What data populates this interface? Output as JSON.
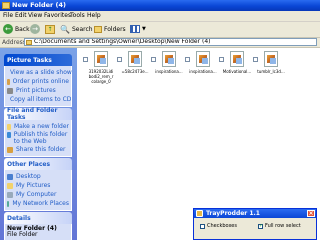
{
  "window": {
    "title": "New Folder (4)"
  },
  "menu": [
    "File",
    "Edit",
    "View",
    "Favorites",
    "Tools",
    "Help"
  ],
  "toolbar": {
    "back_label": "Back",
    "search_label": "Search",
    "folders_label": "Folders"
  },
  "address": {
    "label": "Address",
    "path": "C:\\Documents and Settings\\Owner\\Desktop\\New Folder (4)"
  },
  "sidebar": {
    "picture_tasks": {
      "title": "Picture Tasks",
      "items": [
        "View as a slide show",
        "Order prints online",
        "Print pictures",
        "Copy all items to CD"
      ]
    },
    "file_folder_tasks": {
      "title": "File and Folder Tasks",
      "items": [
        "Make a new folder",
        "Publish this folder to the Web",
        "Share this folder"
      ]
    },
    "other_places": {
      "title": "Other Places",
      "items": [
        "Desktop",
        "My Pictures",
        "My Computer",
        "My Network Places"
      ]
    },
    "details": {
      "title": "Details",
      "name": "New Folder (4)",
      "type": "File Folder"
    }
  },
  "files": [
    {
      "name": "3192032Lidi\nbodi2_rem_r\ncolarge_0"
    },
    {
      "name": "=58c2473e..."
    },
    {
      "name": "inspirationa..."
    },
    {
      "name": "inspirationa..."
    },
    {
      "name": "Motivational..."
    },
    {
      "name": "tumblr_lc3d..."
    }
  ],
  "dialog": {
    "title": "TrayProdder 1.1",
    "option1": "Checkboxes",
    "option2": "Full row select",
    "option2_checked": "✓"
  },
  "colors": {
    "titlebar": "#0a46d6",
    "sidebar": "#6375d6",
    "link": "#215dc6"
  }
}
